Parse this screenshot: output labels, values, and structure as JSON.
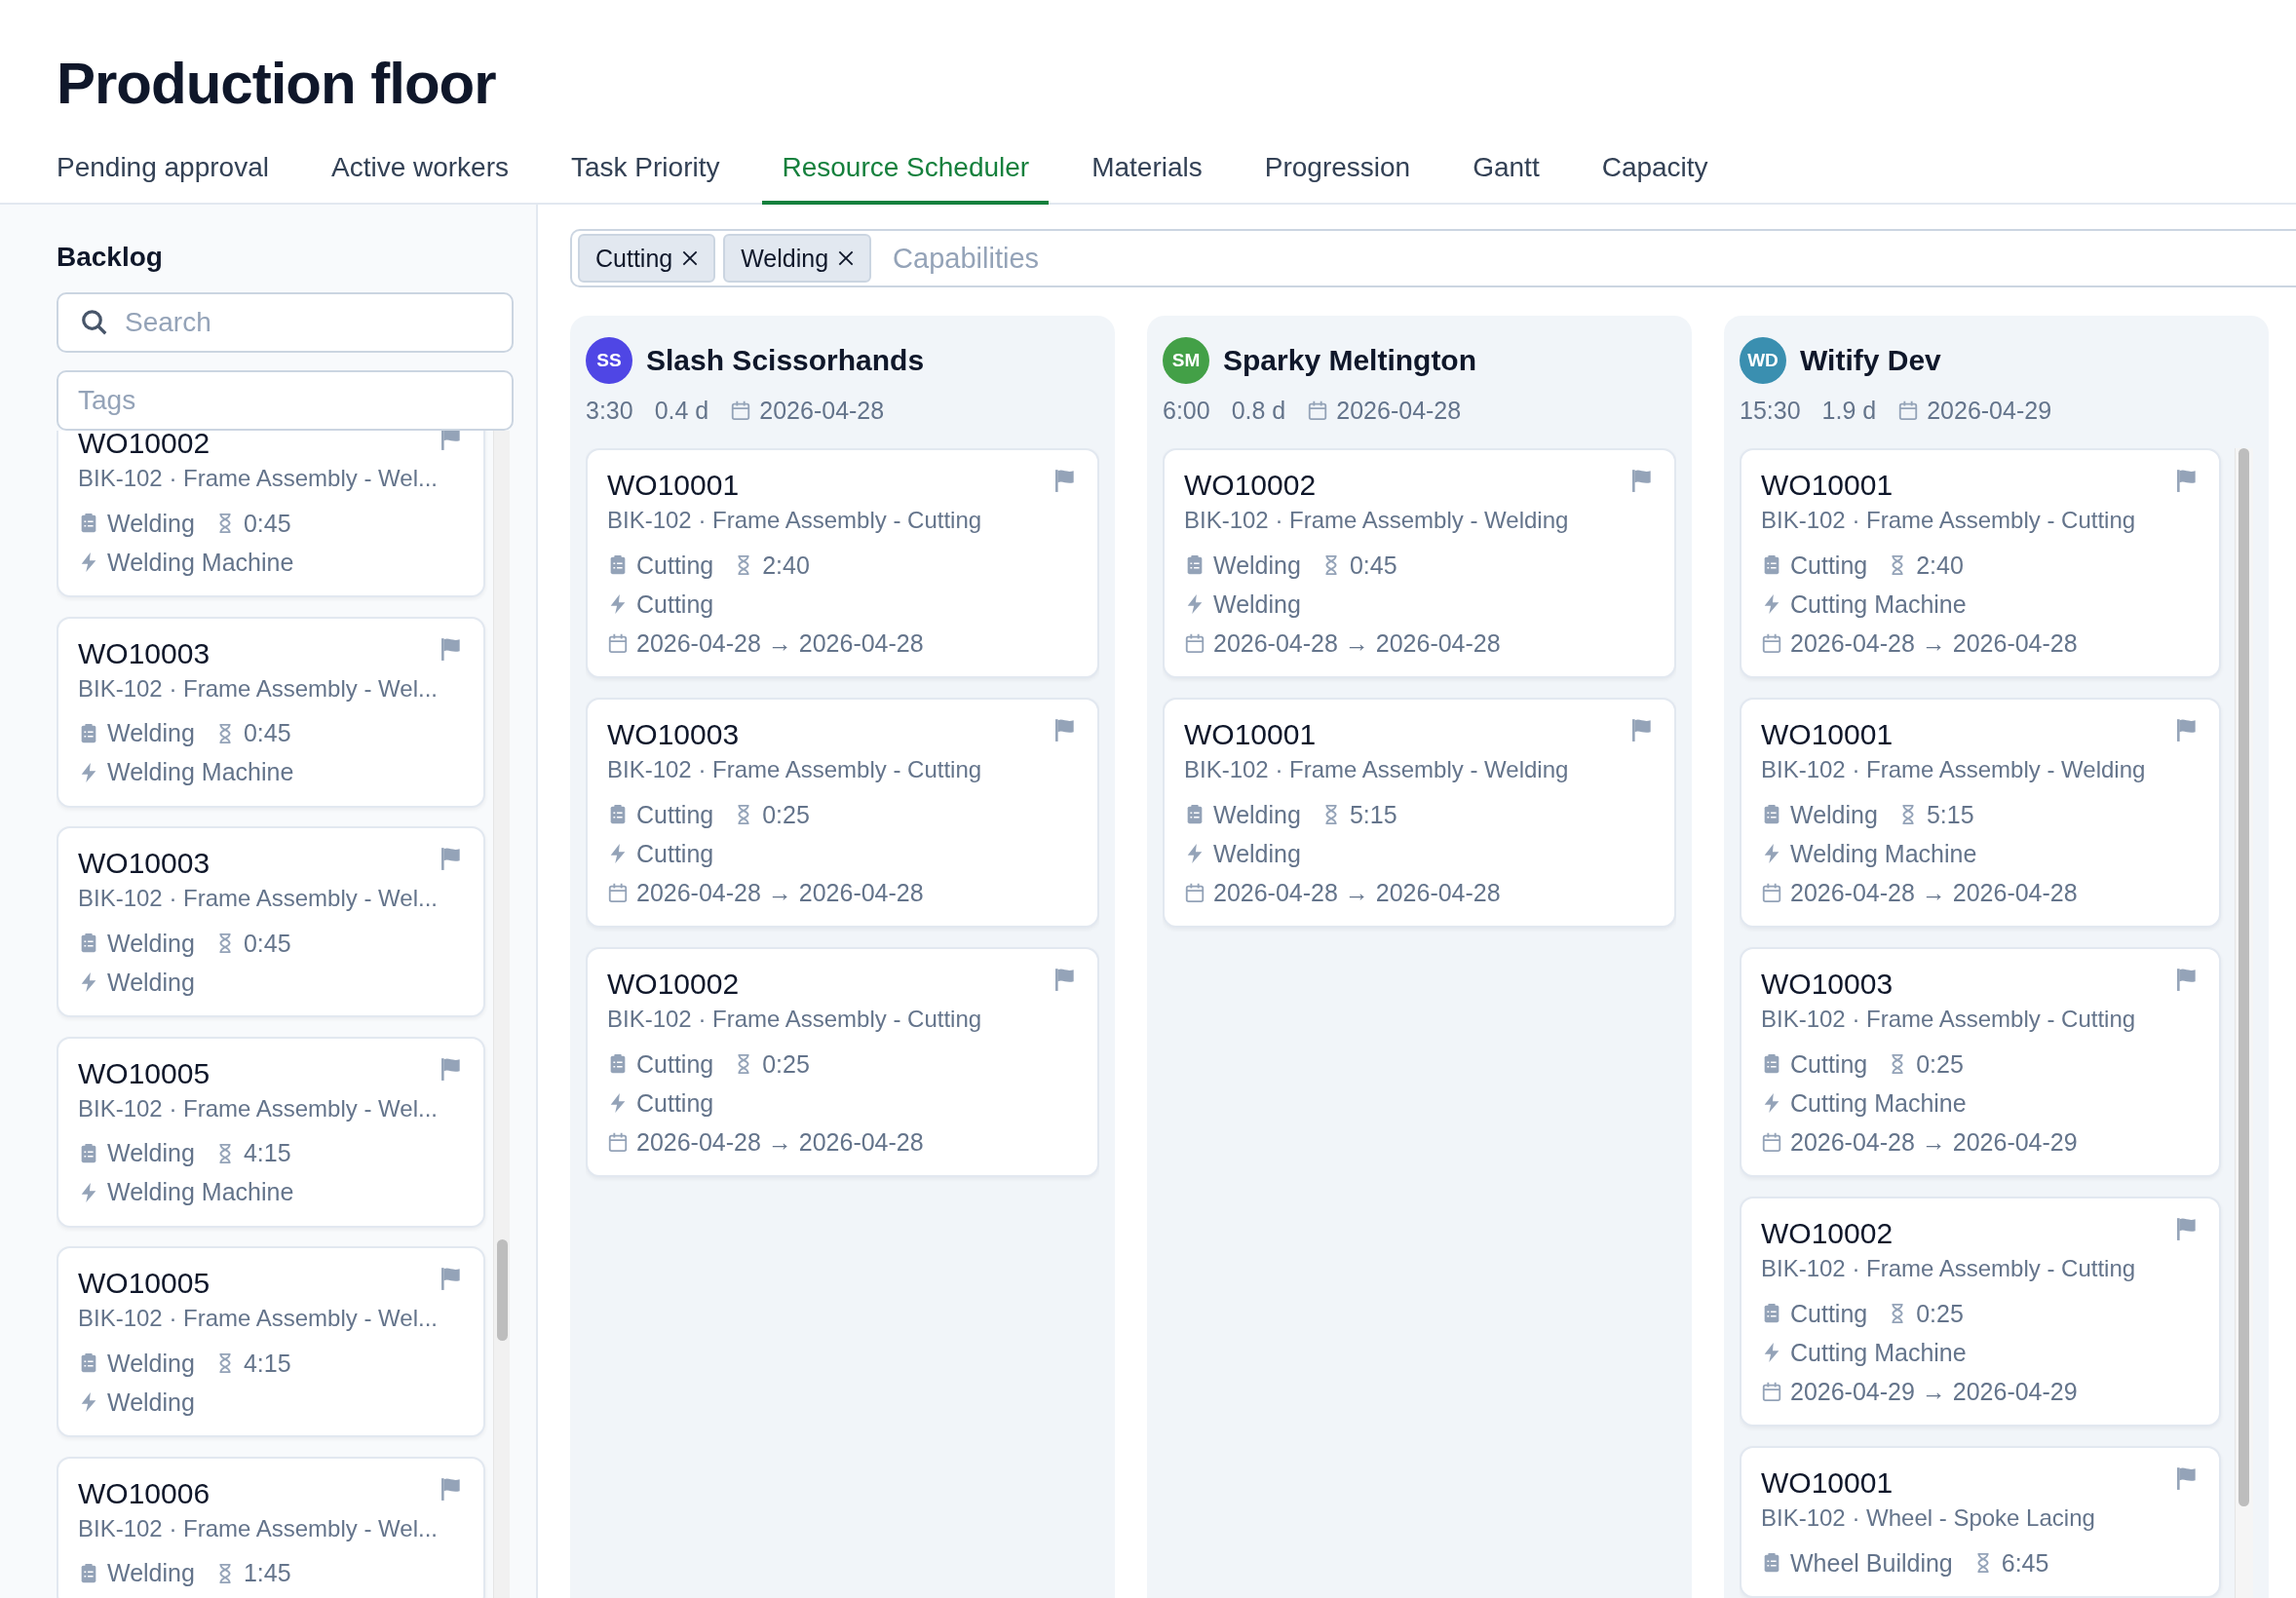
{
  "page": {
    "title": "Production floor"
  },
  "tabs": [
    {
      "label": "Pending approval",
      "selected": false
    },
    {
      "label": "Active workers",
      "selected": false
    },
    {
      "label": "Task Priority",
      "selected": false
    },
    {
      "label": "Resource Scheduler",
      "selected": true
    },
    {
      "label": "Materials",
      "selected": false
    },
    {
      "label": "Progression",
      "selected": false
    },
    {
      "label": "Gantt",
      "selected": false
    },
    {
      "label": "Capacity",
      "selected": false
    }
  ],
  "backlog": {
    "title": "Backlog",
    "search": {
      "placeholder": "Search"
    },
    "tags": {
      "placeholder": "Tags"
    },
    "cards": [
      {
        "id": "WO10002",
        "subtitle": "BIK-102 · Frame Assembly - Wel...",
        "capability": "Welding",
        "duration": "0:45",
        "resource": "Welding Machine"
      },
      {
        "id": "WO10003",
        "subtitle": "BIK-102 · Frame Assembly - Wel...",
        "capability": "Welding",
        "duration": "0:45",
        "resource": "Welding Machine"
      },
      {
        "id": "WO10003",
        "subtitle": "BIK-102 · Frame Assembly - Wel...",
        "capability": "Welding",
        "duration": "0:45",
        "resource": "Welding"
      },
      {
        "id": "WO10005",
        "subtitle": "BIK-102 · Frame Assembly - Wel...",
        "capability": "Welding",
        "duration": "4:15",
        "resource": "Welding Machine"
      },
      {
        "id": "WO10005",
        "subtitle": "BIK-102 · Frame Assembly - Wel...",
        "capability": "Welding",
        "duration": "4:15",
        "resource": "Welding"
      },
      {
        "id": "WO10006",
        "subtitle": "BIK-102 · Frame Assembly - Wel...",
        "capability": "Welding",
        "duration": "1:45"
      }
    ]
  },
  "scheduler": {
    "filter": {
      "chips": [
        "Cutting",
        "Welding"
      ],
      "placeholder": "Capabilities"
    },
    "workers": [
      {
        "initials": "SS",
        "name": "Slash Scissorhands",
        "color": "#4f46e5",
        "hours": "3:30",
        "days": "0.4 d",
        "date": "2026-04-28",
        "cards": [
          {
            "id": "WO10001",
            "subtitle": "BIK-102 · Frame Assembly - Cutting",
            "capability": "Cutting",
            "duration": "2:40",
            "resource": "Cutting",
            "dates": "2026-04-28 → 2026-04-28"
          },
          {
            "id": "WO10003",
            "subtitle": "BIK-102 · Frame Assembly - Cutting",
            "capability": "Cutting",
            "duration": "0:25",
            "resource": "Cutting",
            "dates": "2026-04-28 → 2026-04-28"
          },
          {
            "id": "WO10002",
            "subtitle": "BIK-102 · Frame Assembly - Cutting",
            "capability": "Cutting",
            "duration": "0:25",
            "resource": "Cutting",
            "dates": "2026-04-28 → 2026-04-28"
          }
        ]
      },
      {
        "initials": "SM",
        "name": "Sparky Meltington",
        "color": "#43a047",
        "hours": "6:00",
        "days": "0.8 d",
        "date": "2026-04-28",
        "cards": [
          {
            "id": "WO10002",
            "subtitle": "BIK-102 · Frame Assembly - Welding",
            "capability": "Welding",
            "duration": "0:45",
            "resource": "Welding",
            "dates": "2026-04-28 → 2026-04-28"
          },
          {
            "id": "WO10001",
            "subtitle": "BIK-102 · Frame Assembly - Welding",
            "capability": "Welding",
            "duration": "5:15",
            "resource": "Welding",
            "dates": "2026-04-28 → 2026-04-28"
          }
        ]
      },
      {
        "initials": "WD",
        "name": "Witify Dev",
        "color": "#3a8fb0",
        "hours": "15:30",
        "days": "1.9 d",
        "date": "2026-04-29",
        "cards": [
          {
            "id": "WO10001",
            "subtitle": "BIK-102 · Frame Assembly - Cutting",
            "capability": "Cutting",
            "duration": "2:40",
            "resource": "Cutting Machine",
            "dates": "2026-04-28 → 2026-04-28"
          },
          {
            "id": "WO10001",
            "subtitle": "BIK-102 · Frame Assembly - Welding",
            "capability": "Welding",
            "duration": "5:15",
            "resource": "Welding Machine",
            "dates": "2026-04-28 → 2026-04-28"
          },
          {
            "id": "WO10003",
            "subtitle": "BIK-102 · Frame Assembly - Cutting",
            "capability": "Cutting",
            "duration": "0:25",
            "resource": "Cutting Machine",
            "dates": "2026-04-28 → 2026-04-29"
          },
          {
            "id": "WO10002",
            "subtitle": "BIK-102 · Frame Assembly - Cutting",
            "capability": "Cutting",
            "duration": "0:25",
            "resource": "Cutting Machine",
            "dates": "2026-04-29 → 2026-04-29"
          },
          {
            "id": "WO10001",
            "subtitle": "BIK-102 · Wheel - Spoke Lacing",
            "capability": "Wheel Building",
            "duration": "6:45"
          }
        ]
      }
    ]
  }
}
